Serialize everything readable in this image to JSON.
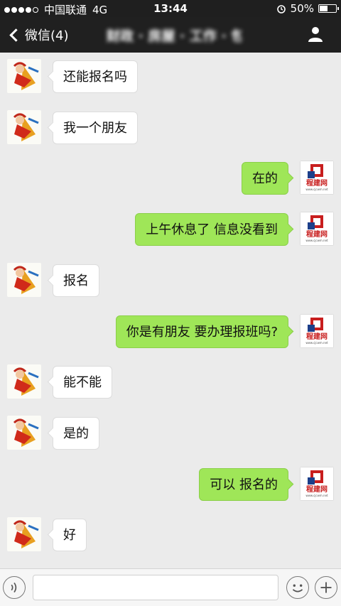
{
  "status_bar": {
    "carrier": "中国联通",
    "network": "4G",
    "time": "13:44",
    "battery": "50%",
    "battery_level": 0.5
  },
  "nav": {
    "back_label": "微信(4)",
    "title": "财政 · 房屋 · 工作 · 包报"
  },
  "avatars": {
    "right_logo_text": "程建网",
    "right_logo_sub": "www.cjcwm.net"
  },
  "messages": [
    {
      "side": "left",
      "text": "还能报名吗"
    },
    {
      "side": "left",
      "text": "我一个朋友"
    },
    {
      "side": "right",
      "text": "在的"
    },
    {
      "side": "right",
      "text": "上午休息了 信息没看到"
    },
    {
      "side": "left",
      "text": "报名"
    },
    {
      "side": "right",
      "text": "你是有朋友 要办理报班吗?"
    },
    {
      "side": "left",
      "text": "能不能"
    },
    {
      "side": "left",
      "text": "是的"
    },
    {
      "side": "right",
      "text": "可以 报名的"
    },
    {
      "side": "left",
      "text": "好"
    },
    {
      "side": "right",
      "text": ""
    }
  ],
  "colors": {
    "right_bubble": "#9fe658",
    "left_bubble": "#ffffff",
    "background": "#ebebeb",
    "header": "#202020"
  }
}
